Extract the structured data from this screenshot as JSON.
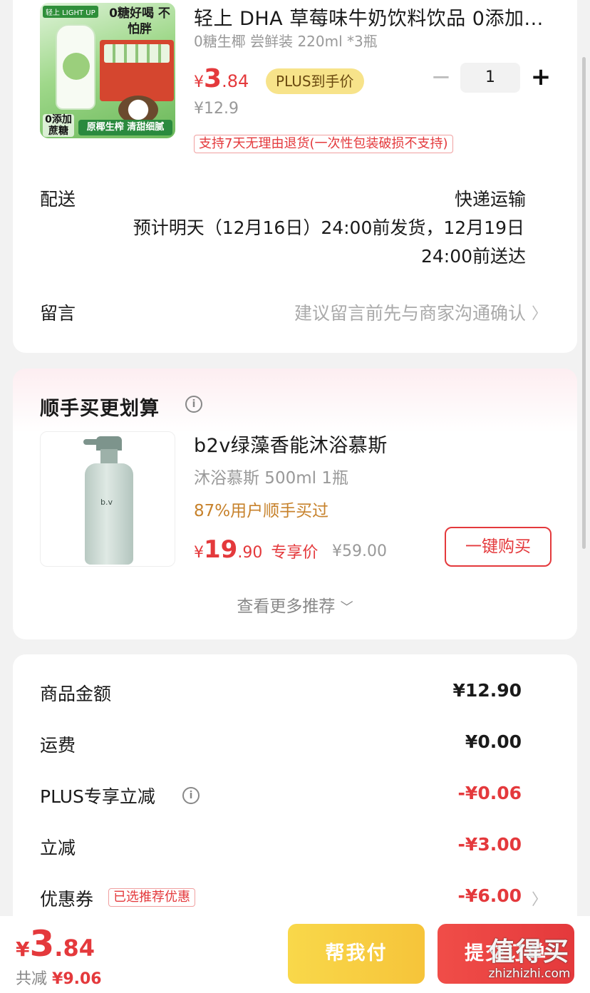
{
  "product": {
    "title": "轻上 DHA 草莓味牛奶饮料饮品 0添加...",
    "spec": "0糖生椰 尝鲜装 220ml *3瓶",
    "price_yen": "¥",
    "price_int": "3",
    "price_dec": ".84",
    "plus_tag": "PLUS到手价",
    "original_price": "¥12.9",
    "quantity": "1",
    "minus": "−",
    "plus": "+",
    "return_policy": "支持7天无理由退货(一次性包装破损不支持)",
    "image": {
      "brand": "轻上 LIGHT UP",
      "banner": "0糖好喝 不怕胖",
      "badge_left": "0添加 蔗糖",
      "badge_bottom": "原椰生榨 清甜细腻"
    }
  },
  "shipping": {
    "label": "配送",
    "method": "快递运输",
    "line1": "预计明天（12月16日）24:00前发货，12月19日",
    "line2": "24:00前送达"
  },
  "memo": {
    "label": "留言",
    "placeholder": "建议留言前先与商家沟通确认"
  },
  "recommend": {
    "title": "顺手买更划算",
    "item": {
      "name": "b2v绿藻香能沐浴慕斯",
      "spec": "沐浴慕斯 500ml 1瓶",
      "bought": "87%用户顺手买过",
      "price_yen": "¥",
      "price_int": "19",
      "price_dec": ".90",
      "price_tag": "专享价",
      "original_price": "¥59.00",
      "buy_label": "一键购买",
      "image_label": "b.v"
    },
    "more": "查看更多推荐"
  },
  "summary": {
    "rows": [
      {
        "label": "商品金额",
        "value": "¥12.90"
      },
      {
        "label": "运费",
        "value": "¥0.00"
      },
      {
        "label": "PLUS专享立减",
        "value": "-¥0.06"
      },
      {
        "label": "立减",
        "value": "-¥3.00"
      },
      {
        "label": "优惠券",
        "value": "-¥6.00",
        "tag": "已选推荐优惠"
      }
    ]
  },
  "footer": {
    "total_yen": "¥",
    "total_int": "3",
    "total_dec": ".84",
    "save_label": "共减",
    "save_value": "¥9.06",
    "help_pay": "帮我付",
    "submit": "提交订单",
    "watermark_big": "值得买",
    "watermark_small": "zhizhizhi.com"
  },
  "colors": {
    "accent_red": "#e4393c",
    "plus_gold": "#f7e38a",
    "help_yellow": "#f6c43a"
  }
}
